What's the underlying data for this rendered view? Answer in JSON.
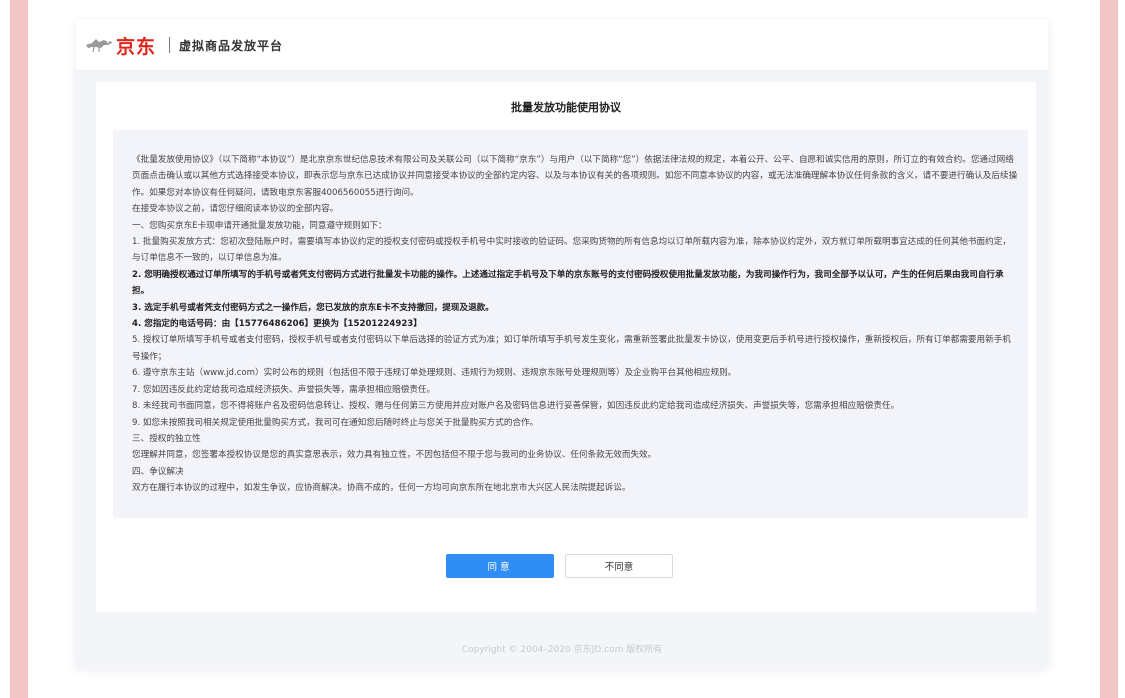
{
  "header": {
    "logo_text": "京东",
    "platform_name": "虚拟商品发放平台"
  },
  "agreement": {
    "title": "批量发放功能使用协议",
    "paragraphs": [
      {
        "text": "《批量发放使用协议》（以下简称“本协议”）是北京京东世纪信息技术有限公司及关联公司（以下简称“京东”）与用户（以下简称“您”）依据法律法规的规定，本着公开、公平、自愿和诚实信用的原则，所订立的有效合约。您通过网络页面点击确认或以其他方式选择接受本协议，即表示您与京东已达成协议并同意接受本协议的全部约定内容、以及与本协议有关的各项规则。如您不同意本协议的内容，或无法准确理解本协议任何条款的含义，请不要进行确认及后续操作。如果您对本协议有任何疑问，请致电京东客服4006560055进行询问。",
        "bold": false
      },
      {
        "text": "在接受本协议之前，请您仔细阅读本协议的全部内容。",
        "bold": false
      },
      {
        "text": "一、您购买京东E卡现申请开通批量发放功能，同意遵守规则如下：",
        "bold": false
      },
      {
        "text": "1. 批量购买发放方式：您初次登陆账户时，需要填写本协议约定的授权支付密码或授权手机号中实时接收的验证码。您采购货物的所有信息均以订单所载内容为准，除本协议约定外，双方就订单所载明事宜达成的任何其他书面约定，与订单信息不一致的，以订单信息为准。",
        "bold": false
      },
      {
        "text": "2. 您明确授权通过订单所填写的手机号或者凭支付密码方式进行批量发卡功能的操作。上述通过指定手机号及下单的京东账号的支付密码授权使用批量发放功能，为我司操作行为，我司全部予以认可，产生的任何后果由我司自行承担。",
        "bold": true
      },
      {
        "text": "3. 选定手机号或者凭支付密码方式之一操作后，您已发放的京东E卡不支持撤回，提现及退款。",
        "bold": true
      },
      {
        "text": "4. 您指定的电话号码：由【15776486206】更换为【15201224923】",
        "bold": true
      },
      {
        "text": "5. 授权订单所填写手机号或者支付密码，授权手机号或者支付密码以下单后选择的验证方式为准；如订单所填写手机号发生变化，需重新签署此批量发卡协议，使用变更后手机号进行授权操作，重新授权后，所有订单都需要用新手机号操作；",
        "bold": false
      },
      {
        "text": "6. 遵守京东主站（www.jd.com）实时公布的规则（包括但不限于违规订单处理规则、违规行为规则、违规京东账号处理规则等）及企业购平台其他相应规则。",
        "bold": false
      },
      {
        "text": "7. 您如因违反此约定给我司造成经济损失、声誉损失等，需承担相应赔偿责任。",
        "bold": false
      },
      {
        "text": "8. 未经我司书面同意，您不得将账户名及密码信息转让、授权、赠与任何第三方使用并应对账户名及密码信息进行妥善保管，如因违反此约定给我司造成经济损失、声誉损失等，您需承担相应赔偿责任。",
        "bold": false
      },
      {
        "text": "9. 如您未按照我司相关规定使用批量购买方式，我司可在通知您后随时终止与您关于批量购买方式的合作。",
        "bold": false
      },
      {
        "text": "三、授权的独立性",
        "bold": false
      },
      {
        "text": "您理解并同意，您签署本授权协议是您的真实意思表示，效力具有独立性，不因包括但不限于您与我司的业务协议、任何条款无效而失效。",
        "bold": false
      },
      {
        "text": "四、争议解决",
        "bold": false
      },
      {
        "text": "双方在履行本协议的过程中，如发生争议，应协商解决。协商不成的，任何一方均可向京东所在地北京市大兴区人民法院提起诉讼。",
        "bold": false
      }
    ]
  },
  "actions": {
    "agree_label": "同意",
    "disagree_label": "不同意"
  },
  "footer": {
    "copyright": "Copyright © 2004–2020 京东JD.com 版权所有"
  },
  "colors": {
    "brand_red": "#e1251b",
    "primary_blue": "#2f8df5",
    "side_pink": "#f2c6c6"
  }
}
